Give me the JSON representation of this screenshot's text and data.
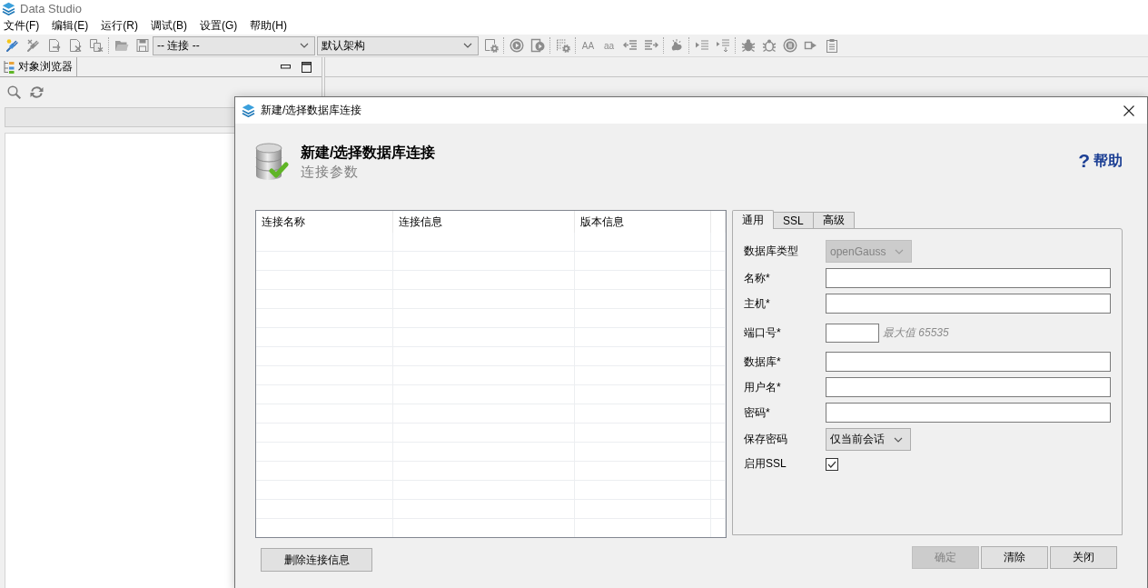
{
  "app": {
    "title": "Data Studio"
  },
  "menu": [
    "文件(F)",
    "编辑(E)",
    "运行(R)",
    "调试(B)",
    "设置(G)",
    "帮助(H)"
  ],
  "toolbar": {
    "connection_dropdown": "-- 连接 --",
    "schema_dropdown": "默认架构",
    "case_buttons": [
      "AA",
      "aa"
    ]
  },
  "object_browser": {
    "tab": "对象浏览器"
  },
  "dialog": {
    "title": "新建/选择数据库连接",
    "heading": "新建/选择数据库连接",
    "subheading": "连接参数",
    "help": {
      "icon": "?",
      "label": "帮助"
    },
    "table": {
      "columns": [
        "连接名称",
        "连接信息",
        "版本信息"
      ]
    },
    "tabs": [
      {
        "label": "通用",
        "selected": true
      },
      {
        "label": "SSL",
        "selected": false
      },
      {
        "label": "高级",
        "selected": false
      }
    ],
    "form": {
      "fields": [
        {
          "kind": "select",
          "label": "数据库类型",
          "value": "openGauss",
          "disabled": true
        },
        {
          "kind": "text",
          "label": "名称*"
        },
        {
          "kind": "text",
          "label": "主机*"
        },
        {
          "kind": "port",
          "label": "端口号*",
          "hint": "最大值 65535"
        },
        {
          "kind": "text",
          "label": "数据库*"
        },
        {
          "kind": "text",
          "label": "用户名*"
        },
        {
          "kind": "password",
          "label": "密码*"
        },
        {
          "kind": "select",
          "label": "保存密码",
          "value": "仅当前会话",
          "disabled": false
        },
        {
          "kind": "checkbox",
          "label": "启用SSL",
          "checked": true
        }
      ]
    },
    "delete_button": "删除连接信息",
    "buttons": [
      {
        "label": "确定",
        "disabled": true
      },
      {
        "label": "清除",
        "disabled": false
      },
      {
        "label": "关闭",
        "disabled": false
      }
    ]
  }
}
